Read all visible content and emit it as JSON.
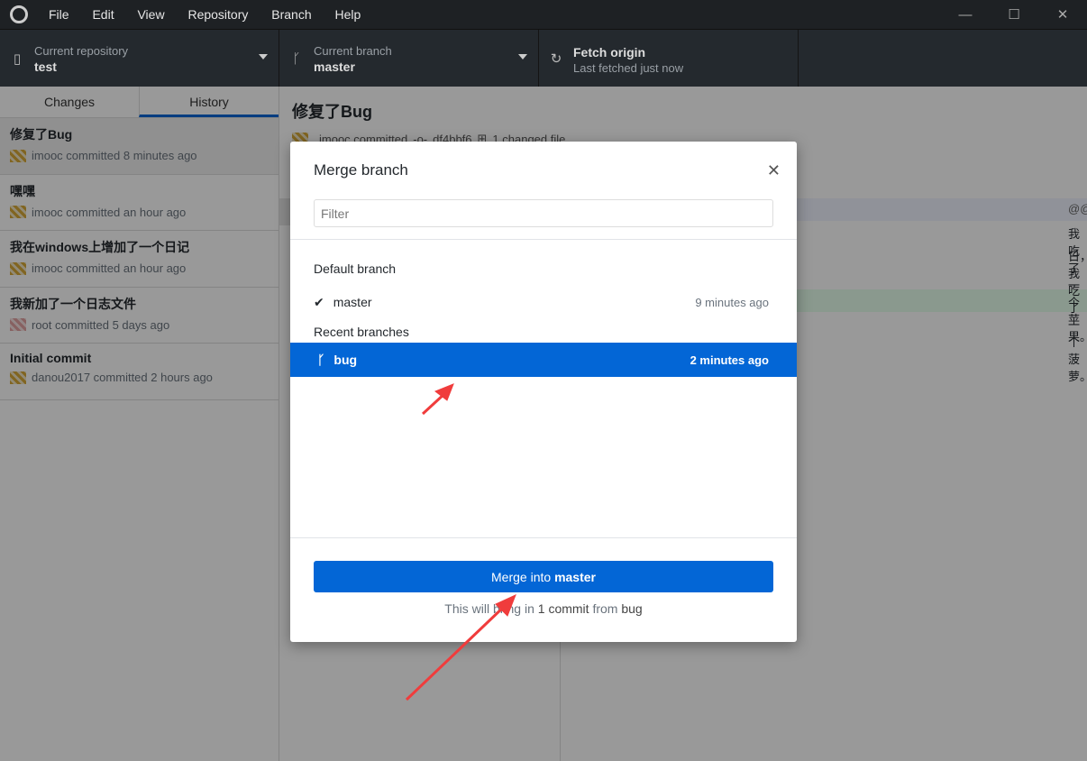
{
  "menu": [
    "File",
    "Edit",
    "View",
    "Repository",
    "Branch",
    "Help"
  ],
  "toolbar": {
    "repo": {
      "label": "Current repository",
      "value": "test"
    },
    "branch": {
      "label": "Current branch",
      "value": "master"
    },
    "fetch": {
      "label": "Fetch origin",
      "value": "Last fetched just now"
    }
  },
  "sidebar": {
    "tabs": [
      "Changes",
      "History"
    ],
    "active_tab": "History",
    "commits": [
      {
        "title": "修复了Bug",
        "meta": "imooc committed 8 minutes ago"
      },
      {
        "title": "嘿嘿",
        "meta": "imooc committed an hour ago"
      },
      {
        "title": "我在windows上增加了一个日记",
        "meta": "imooc committed an hour ago"
      },
      {
        "title": "我新加了一个日志文件",
        "meta": "root committed 5 days ago"
      },
      {
        "title": "Initial commit",
        "meta": "danou2017 committed 2 hours ago"
      }
    ]
  },
  "commit": {
    "title": "修复了Bug",
    "author": "imooc committed",
    "sha": "df4bbf6",
    "files": "1 changed file",
    "diff": {
      "hunk": "@@",
      "line1": "我吃了一个苹果。",
      "line2": "日，我吃了一个菠萝。"
    }
  },
  "dialog": {
    "title": "Merge branch",
    "filter_placeholder": "Filter",
    "default_group": "Default branch",
    "recent_group": "Recent branches",
    "default_branch": {
      "name": "master",
      "time": "9 minutes ago"
    },
    "recent": [
      {
        "name": "bug",
        "time": "2 minutes ago",
        "selected": true
      }
    ],
    "button": {
      "prefix": "Merge into ",
      "target": "master"
    },
    "hint": {
      "prefix": "This will bring in ",
      "count": "1 commit",
      "mid": " from ",
      "branch": "bug"
    }
  },
  "colors": {
    "accent": "#0366d6",
    "annotation": "#f03c3c"
  }
}
